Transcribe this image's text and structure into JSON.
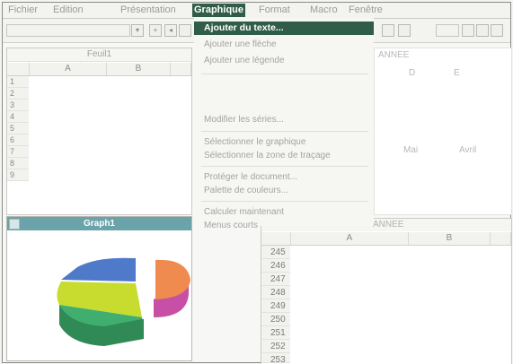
{
  "menubar": {
    "items": [
      "Fichier",
      "Edition",
      "Présentation",
      "Graphique",
      "Format",
      "Macro",
      "Fenêtre"
    ],
    "active": "Graphique"
  },
  "graph_menu": {
    "items": [
      {
        "label": "Ajouter du texte...",
        "highlighted": true
      },
      {
        "label": "Ajouter une flèche"
      },
      {
        "label": "Ajouter une légende"
      },
      {
        "label": "Modifier les séries..."
      },
      {
        "label": "Sélectionner le graphique"
      },
      {
        "label": "Sélectionner la zone de traçage"
      },
      {
        "label": "Protéger le document..."
      },
      {
        "label": "Palette de couleurs..."
      },
      {
        "label": "Calculer maintenant"
      },
      {
        "label": "Menus courts"
      }
    ]
  },
  "window_feuil1": {
    "title": "Feuil1",
    "columns": [
      "A",
      "B"
    ],
    "rows": [
      "1",
      "2",
      "3",
      "4",
      "5",
      "6",
      "7",
      "8",
      "9"
    ]
  },
  "window_graph": {
    "title": "Graph1",
    "colors": {
      "blue": "#4f79c9",
      "orange": "#f08b4f",
      "pink": "#e36ec4",
      "yellow": "#c7dc2f",
      "green": "#3fae6f"
    }
  },
  "window_back": {
    "title": "ANNEE",
    "columns": [
      "D",
      "E"
    ],
    "labels": [
      "Mai",
      "Avril"
    ]
  },
  "window_front": {
    "title": "ANNEE",
    "columns": [
      "A",
      "B"
    ],
    "rows": [
      "245",
      "246",
      "247",
      "248",
      "249",
      "250",
      "251",
      "252",
      "253"
    ]
  }
}
